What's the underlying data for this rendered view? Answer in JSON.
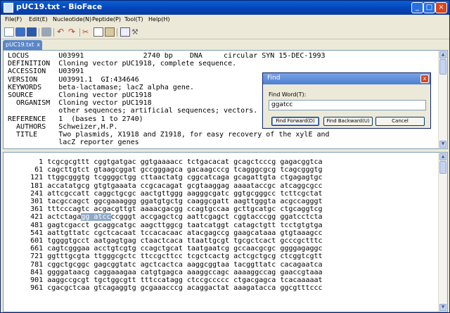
{
  "window": {
    "title": "pUC19.txt - BioFace"
  },
  "menu": [
    "File(F)",
    "Edit(E)",
    "Nucleotide(N)",
    "Peptide(P)",
    "Tool(T)",
    "Help(H)"
  ],
  "tab": {
    "label": "pUC19.txt",
    "close": "x"
  },
  "header_lines": [
    "LOCUS       U03991              2740 bp    DNA     circular SYN 15-DEC-1993",
    "DEFINITION  Cloning vector pUC1918, complete sequence.",
    "ACCESSION   U03991",
    "VERSION     U03991.1  GI:434646",
    "KEYWORDS    beta-lactamase; lacZ alpha gene.",
    "SOURCE      Cloning vector pUC1918",
    "  ORGANISM  Cloning vector pUC1918",
    "            other sequences; artificial sequences; vectors.",
    "REFERENCE   1  (bases 1 to 2740)",
    "  AUTHORS   Schweizer,H.P.",
    "  TITLE     Two plasmids, X1918 and Z1918, for easy recovery of the xylE and",
    "            lacZ reporter genes"
  ],
  "sequence_rows": [
    {
      "pos": "1",
      "seq": [
        "tcgcgcgttt",
        "cggtgatgac",
        "ggtgaaaacc",
        "tctgacacat",
        "gcagctcccg",
        "gagacggtca"
      ]
    },
    {
      "pos": "61",
      "seq": [
        "cagcttgtct",
        "gtaagcggat",
        "gccgggagca",
        "gacaagcccg",
        "tcagggcgcg",
        "tcagcgggtg"
      ]
    },
    {
      "pos": "121",
      "seq": [
        "ttggcgggtg",
        "tcggggctgg",
        "cttaactatg",
        "cggcatcaga",
        "gcagattgta",
        "ctgagagtgc"
      ]
    },
    {
      "pos": "181",
      "seq": [
        "accatatgcg",
        "gtgtgaaata",
        "ccgcacagat",
        "gcgtaaggag",
        "aaaataccgc",
        "atcaggcgcc"
      ]
    },
    {
      "pos": "241",
      "seq": [
        "attcgccatt",
        "caggctgcgc",
        "aactgttggg",
        "aagggcgatc",
        "ggtgcgggcc",
        "tcttcgctat"
      ]
    },
    {
      "pos": "301",
      "seq": [
        "tacgccagct",
        "ggcgaaaggg",
        "ggatgtgctg",
        "caaggcgatt",
        "aagttgggta",
        "acgccagggt"
      ]
    },
    {
      "pos": "361",
      "seq": [
        "tttcccagtc",
        "acgacgttgt",
        "aaaacgacgg",
        "ccagtgccaa",
        "gcttgcatgc",
        "ctgcaggtcg"
      ]
    },
    {
      "pos": "421",
      "seq": [
        "actctagagg",
        "atccccgggt",
        "accgagctcg",
        "aattcgagct",
        "cggtacccgg",
        "ggatcctcta"
      ]
    },
    {
      "pos": "481",
      "seq": [
        "gagtcgacct",
        "gcaggcatgc",
        "aagcttggcg",
        "taatcatggt",
        "catagctgtt",
        "tcctgtgtga"
      ]
    },
    {
      "pos": "541",
      "seq": [
        "aattgttatc",
        "cgctcacaat",
        "tccacacaac",
        "atacgagccg",
        "gaagcataaa",
        "gtgtaaagcc"
      ]
    },
    {
      "pos": "601",
      "seq": [
        "tggggtgcct",
        "aatgagtgag",
        "ctaactcaca",
        "ttaattgcgt",
        "tgcgctcact",
        "gcccgctttc"
      ]
    },
    {
      "pos": "661",
      "seq": [
        "cagtcgggaa",
        "acctgtcgtg",
        "ccagctgcat",
        "taatgaatcg",
        "gccaacgcgc",
        "ggggagaggc"
      ]
    },
    {
      "pos": "721",
      "seq": [
        "ggtttgcgta",
        "ttgggcgctc",
        "ttccgcttcc",
        "tcgctcactg",
        "actcgctgcg",
        "ctcggtcgtt"
      ]
    },
    {
      "pos": "781",
      "seq": [
        "cggctgcggc",
        "gagcggtatc",
        "agctcactca",
        "aaggcggtaa",
        "tacggttatc",
        "cacagaatca"
      ]
    },
    {
      "pos": "841",
      "seq": [
        "ggggataacg",
        "caggaaagaa",
        "catgtgagca",
        "aaaggccagc",
        "aaaaggccag",
        "gaaccgtaaa"
      ]
    },
    {
      "pos": "901",
      "seq": [
        "aaggccgcgt",
        "tgctggcgtt",
        "tttccatagg",
        "ctccgccccc",
        "ctgacgagca",
        "tcacaaaaat"
      ]
    },
    {
      "pos": "961",
      "seq": [
        "cgacgctcaa",
        "gtcagaggtg",
        "gcgaaacccg",
        "acaggactat",
        "aaagataccа",
        "ggcgtttccc"
      ]
    }
  ],
  "highlight": {
    "row": 7,
    "before": "actctaga",
    "match": "gg atcc",
    "after": "ccgggt"
  },
  "dialog": {
    "title": "Find",
    "label": "Find Word(T):",
    "value": "ggatcc",
    "buttons": [
      "Find Forward(D)",
      "Find Backward(U)",
      "Cancel"
    ],
    "close": "x"
  },
  "colors": {
    "titlebar": "#0443b5",
    "tab": "#5a86c9",
    "highlight": "#8fa8c8"
  }
}
